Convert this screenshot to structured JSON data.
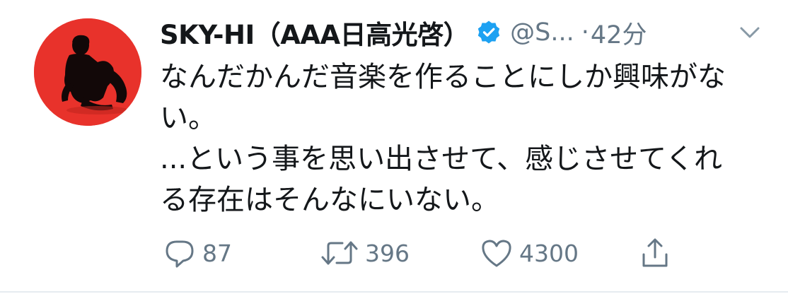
{
  "tweet": {
    "author": {
      "display_name": "SKY-HI（AAA日高光啓）",
      "verified": true,
      "handle": "@S...",
      "avatar": "avatar-photo"
    },
    "separator": "·",
    "time": "42分",
    "text_lines": [
      "なんだかんだ音楽を作ることにしか興味がな",
      "い。",
      "...という事を思い出させて、感じさせてくれ",
      "る存在はそんなにいない。"
    ],
    "actions": {
      "reply_count": "87",
      "retweet_count": "396",
      "like_count": "4300"
    }
  },
  "icons": {
    "verified": "verified-badge-icon",
    "menu": "chevron-down-icon",
    "reply": "reply-icon",
    "retweet": "retweet-icon",
    "like": "heart-icon",
    "share": "share-icon"
  },
  "colors": {
    "text": "#14171a",
    "secondary": "#657786",
    "verified_blue": "#1da1f2",
    "avatar_background": "#e8322b"
  }
}
